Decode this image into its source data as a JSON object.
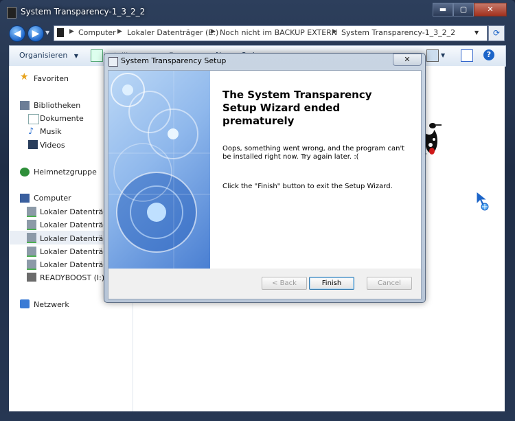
{
  "window": {
    "title": "System Transparency-1_3_2_2",
    "caption": {
      "minimize": "▬",
      "maximize": "▢",
      "close": "✕"
    }
  },
  "address": {
    "crumbs": [
      "Computer",
      "Lokaler Datenträger (E:)",
      "Noch nicht im BACKUP EXTERN",
      "System Transparency-1_3_2_2"
    ],
    "separator": "▶"
  },
  "toolbar": {
    "organize": "Organisieren",
    "install": "Installieren",
    "burn": "Brennen",
    "new_folder": "Neuer Ordner"
  },
  "navpane": {
    "favorites": "Favoriten",
    "libraries": "Bibliotheken",
    "documents": "Dokumente",
    "music": "Musik",
    "videos": "Videos",
    "homegroup": "Heimnetzgruppe",
    "computer": "Computer",
    "drives": [
      "Lokaler Datenträger",
      "Lokaler Datenträger",
      "Lokaler Datenträger",
      "Lokaler Datenträger",
      "Lokaler Datenträger"
    ],
    "readyboost": "READYBOOST (I:)",
    "network": "Netzwerk"
  },
  "dialog": {
    "title": "System Transparency Setup",
    "close": "✕",
    "heading": "The System Transparency Setup Wizard ended prematurely",
    "message": "Oops, something went wrong, and the program can't be installed right now. Try again later. :(",
    "hint": "Click the \"Finish\" button to exit the Setup Wizard.",
    "back_label": "< Back",
    "finish_label": "Finish",
    "cancel_label": "Cancel"
  },
  "colors": {
    "accent": "#1b64c8",
    "chrome": "#2d3f5c",
    "banner": "#8fb8ec"
  }
}
